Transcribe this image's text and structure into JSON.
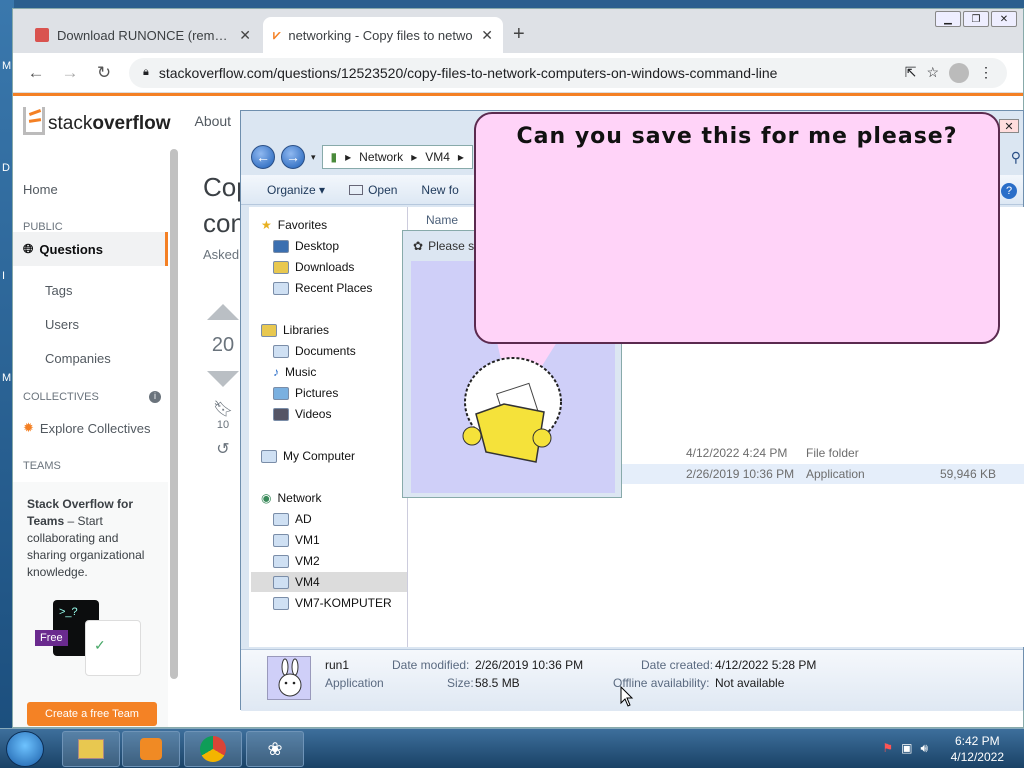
{
  "browser": {
    "tabs": [
      {
        "title": "Download RUNONCE (remember"
      },
      {
        "title": "networking - Copy files to netwo"
      }
    ],
    "url": "stackoverflow.com/questions/12523520/copy-files-to-network-computers-on-windows-command-line"
  },
  "so": {
    "logo_a": "stack",
    "logo_b": "overflow",
    "about": "About",
    "nav": {
      "home": "Home",
      "public": "PUBLIC",
      "questions": "Questions",
      "tags": "Tags",
      "users": "Users",
      "companies": "Companies",
      "collectives": "COLLECTIVES",
      "explore_collectives": "Explore Collectives",
      "teams": "TEAMS"
    },
    "teams_box": {
      "title": "Stack Overflow for Teams",
      "text": " – Start collaborating and sharing organizational knowledge.",
      "free": "Free",
      "cta": "Create a free Team"
    },
    "title_line1": "Cop",
    "title_line2": "con",
    "asked": "Asked",
    "votes": "20",
    "bookmarks": "10"
  },
  "explorer": {
    "breadcrumb": [
      "Network",
      "VM4"
    ],
    "toolbar": {
      "organize": "Organize",
      "open": "Open",
      "new_folder": "New fo"
    },
    "tree": {
      "favorites": "Favorites",
      "desktop": "Desktop",
      "downloads": "Downloads",
      "recent": "Recent Places",
      "libraries": "Libraries",
      "documents": "Documents",
      "music": "Music",
      "pictures": "Pictures",
      "videos": "Videos",
      "my_computer": "My Computer",
      "network": "Network",
      "ad": "AD",
      "vm1": "VM1",
      "vm2": "VM2",
      "vm4": "VM4",
      "vm7": "VM7-KOMPUTER"
    },
    "column_name": "Name",
    "rows": [
      {
        "date": "4/12/2022 4:24 PM",
        "type": "File folder",
        "size": ""
      },
      {
        "date": "2/26/2019 10:36 PM",
        "type": "Application",
        "size": "59,946 KB"
      }
    ],
    "details": {
      "name": "run1",
      "kind": "Application",
      "modified_label": "Date modified:",
      "modified": "2/26/2019 10:36 PM",
      "size_label": "Size:",
      "size": "58.5 MB",
      "created_label": "Date created:",
      "created": "4/12/2022 5:28 PM",
      "offline_label": "Offline availability:",
      "offline": "Not available"
    }
  },
  "dialog": {
    "title": "Please s"
  },
  "bubble": {
    "text": "Can you save this for me please?"
  },
  "taskbar": {
    "time": "6:42 PM",
    "date": "4/12/2022"
  },
  "colors": {
    "so_orange": "#f48024",
    "bubble": "#ffd3f8",
    "folder": "#f5e23a"
  }
}
